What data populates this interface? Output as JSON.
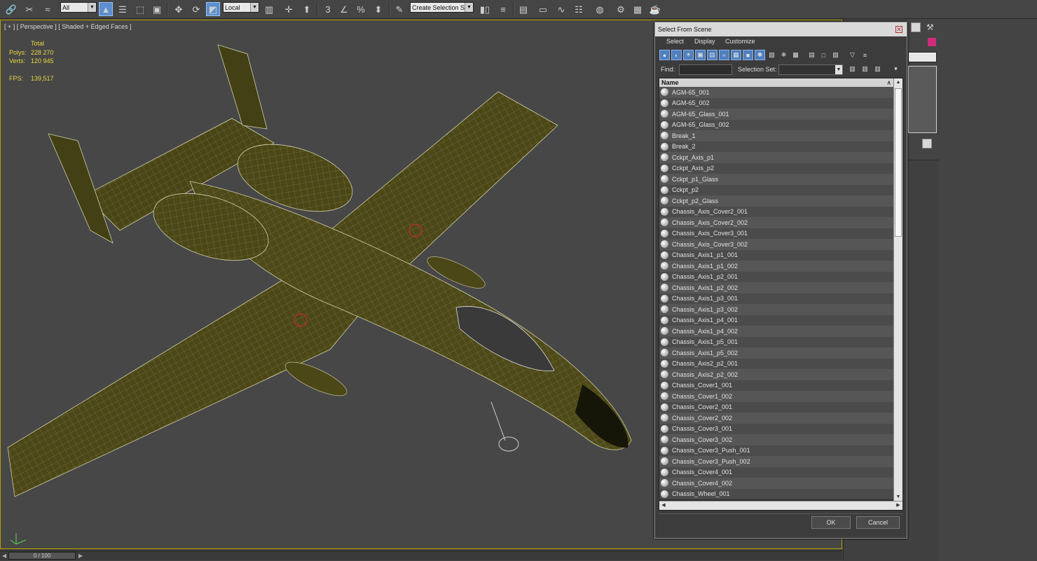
{
  "toolbar": {
    "filter_value": "All",
    "coord_value": "Local",
    "selection_set_value": "Create Selection Se",
    "snap_label": "3",
    "percent_label": "%"
  },
  "viewport": {
    "label": "[ + ] [ Perspective ] [ Shaded + Edged Faces ]",
    "stats": {
      "header": "Total",
      "polys_label": "Polys:",
      "polys_value": "228 270",
      "verts_label": "Verts:",
      "verts_value": "120 945",
      "fps_label": "FPS:",
      "fps_value": "139,517"
    },
    "accent_color": "#b8a000"
  },
  "timeline": {
    "frame_readout": "0 / 100"
  },
  "dialog": {
    "title": "Select From Scene",
    "menu": [
      "Select",
      "Display",
      "Customize"
    ],
    "find_label": "Find:",
    "find_value": "",
    "selection_set_label": "Selection Set:",
    "selection_set_value": "",
    "column_header": "Name",
    "items": [
      "AGM-65_001",
      "AGM-65_002",
      "AGM-65_Glass_001",
      "AGM-65_Glass_002",
      "Break_1",
      "Break_2",
      "Cckpt_Axis_p1",
      "Cckpt_Axis_p2",
      "Cckpt_p1_Glass",
      "Cckpt_p2",
      "Cckpt_p2_Glass",
      "Chassis_Axis_Cover2_001",
      "Chassis_Axis_Cover2_002",
      "Chassis_Axis_Cover3_001",
      "Chassis_Axis_Cover3_002",
      "Chassis_Axis1_p1_001",
      "Chassis_Axis1_p1_002",
      "Chassis_Axis1_p2_001",
      "Chassis_Axis1_p2_002",
      "Chassis_Axis1_p3_001",
      "Chassis_Axis1_p3_002",
      "Chassis_Axis1_p4_001",
      "Chassis_Axis1_p4_002",
      "Chassis_Axis1_p5_001",
      "Chassis_Axis1_p5_002",
      "Chassis_Axis2_p2_001",
      "Chassis_Axis2_p2_002",
      "Chassis_Cover1_001",
      "Chassis_Cover1_002",
      "Chassis_Cover2_001",
      "Chassis_Cover2_002",
      "Chassis_Cover3_001",
      "Chassis_Cover3_002",
      "Chassis_Cover3_Push_001",
      "Chassis_Cover3_Push_002",
      "Chassis_Cover4_001",
      "Chassis_Cover4_002",
      "Chassis_Wheel_001"
    ],
    "ok_label": "OK",
    "cancel_label": "Cancel"
  },
  "icons": {
    "link": "link-icon",
    "unlink": "unlink-icon",
    "bind": "bind-space-warp-icon",
    "select": "select-object-icon",
    "select_by_name": "select-by-name-icon",
    "move": "move-icon",
    "rotate": "rotate-icon",
    "scale": "scale-icon",
    "mirror": "mirror-icon",
    "align": "align-icon",
    "render": "render-teapot-icon"
  }
}
